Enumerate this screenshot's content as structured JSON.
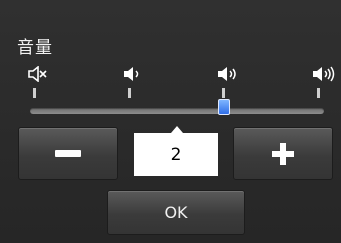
{
  "dialog": {
    "title": "音量"
  },
  "volume": {
    "min": 0,
    "max": 3,
    "value": 2,
    "display_value": "2",
    "levels": [
      {
        "icon": "speaker-mute-icon"
      },
      {
        "icon": "speaker-low-icon"
      },
      {
        "icon": "speaker-medium-icon"
      },
      {
        "icon": "speaker-high-icon"
      }
    ]
  },
  "buttons": {
    "decrease_icon": "minus-icon",
    "increase_icon": "plus-icon",
    "ok_label": "OK"
  },
  "colors": {
    "background": "#2b2b2b",
    "thumb": "#2f6ee8",
    "text": "#ffffff"
  }
}
